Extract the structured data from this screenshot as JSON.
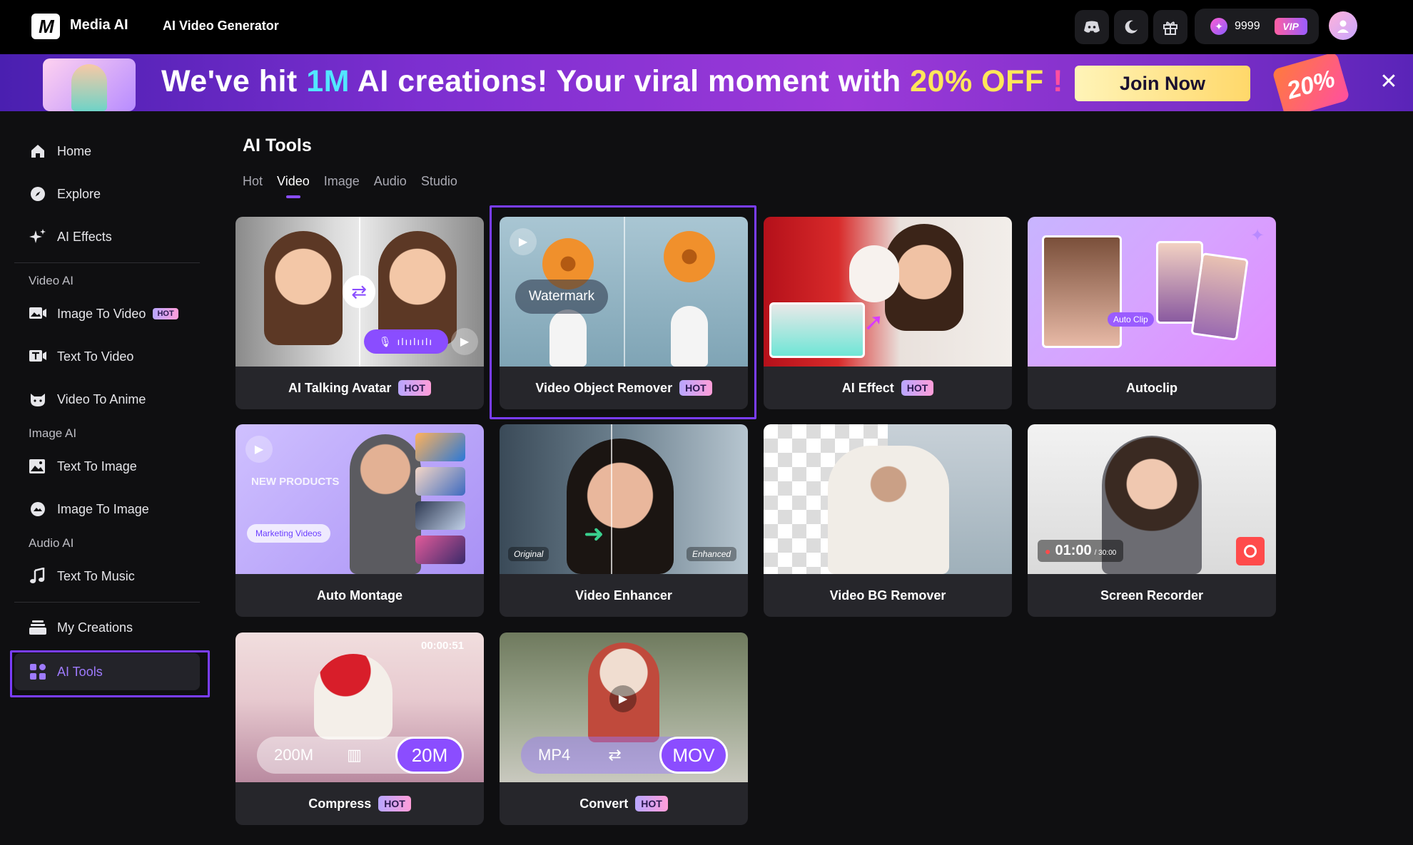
{
  "header": {
    "brand": "Media AI",
    "breadcrumb": "AI Video Generator",
    "credits": "9999",
    "vip": "VIP"
  },
  "banner": {
    "text_pre": "We've hit ",
    "text_1m": "1M",
    "text_mid": " AI creations! Your viral moment with ",
    "text_off": "20% OFF",
    "text_bang": " !",
    "join_label": "Join Now",
    "promo_tag": "20%"
  },
  "sidebar": {
    "home": "Home",
    "explore": "Explore",
    "ai_effects": "AI Effects",
    "section_video": "Video AI",
    "image_to_video": "Image To Video",
    "image_to_video_badge": "HOT",
    "text_to_video": "Text To Video",
    "video_to_anime": "Video To Anime",
    "section_image": "Image AI",
    "text_to_image": "Text To Image",
    "image_to_image": "Image To Image",
    "section_audio": "Audio AI",
    "text_to_music": "Text To Music",
    "my_creations": "My Creations",
    "ai_tools": "AI Tools"
  },
  "main": {
    "title": "AI Tools",
    "tabs": [
      "Hot",
      "Video",
      "Image",
      "Audio",
      "Studio"
    ],
    "active_tab": "Video",
    "cards": [
      {
        "title": "AI Talking Avatar",
        "badge": "HOT"
      },
      {
        "title": "Video Object Remover",
        "badge": "HOT",
        "overlay": "Watermark"
      },
      {
        "title": "AI Effect",
        "badge": "HOT"
      },
      {
        "title": "Autoclip",
        "overlay": "Auto Clip"
      },
      {
        "title": "Auto Montage",
        "overlay": "NEW PRODUCTS",
        "overlay2": "Marketing Videos"
      },
      {
        "title": "Video Enhancer",
        "overlay": "Original",
        "overlay2": "Enhanced"
      },
      {
        "title": "Video BG Remover"
      },
      {
        "title": "Screen Recorder",
        "overlay": "01:00",
        "overlay2": "/ 30:00"
      },
      {
        "title": "Compress",
        "badge": "HOT",
        "overlay": "200M",
        "overlay2": "20M",
        "time": "00:00:51"
      },
      {
        "title": "Convert",
        "badge": "HOT",
        "overlay": "MP4",
        "overlay2": "MOV"
      }
    ]
  },
  "colors": {
    "accent": "#7a3dff",
    "banner_start": "#4a1fb0",
    "banner_end": "#9b39d8",
    "card_bg": "#26262b"
  }
}
